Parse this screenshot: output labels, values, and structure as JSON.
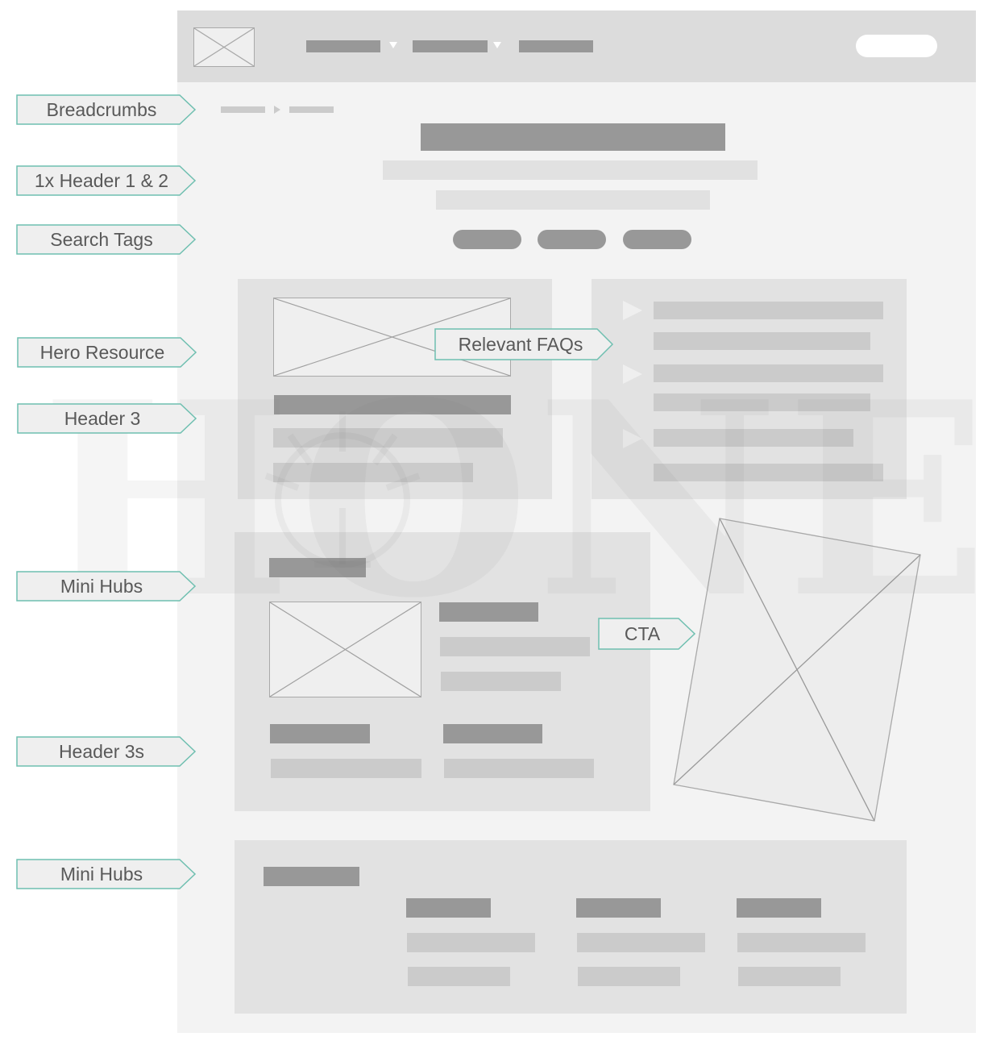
{
  "annotations": [
    {
      "id": "breadcrumbs",
      "label": "Breadcrumbs"
    },
    {
      "id": "header-1-2",
      "label": "1x Header 1 & 2"
    },
    {
      "id": "search-tags",
      "label": "Search Tags"
    },
    {
      "id": "hero-resource",
      "label": "Hero Resource"
    },
    {
      "id": "header-3",
      "label": "Header 3"
    },
    {
      "id": "mini-hubs-1",
      "label": "Mini Hubs"
    },
    {
      "id": "header-3s",
      "label": "Header 3s"
    },
    {
      "id": "mini-hubs-2",
      "label": "Mini Hubs"
    },
    {
      "id": "relevant-faqs",
      "label": "Relevant FAQs"
    },
    {
      "id": "cta",
      "label": "CTA"
    }
  ],
  "watermark": {
    "text": "HONED"
  },
  "nav": {
    "items": [
      {
        "name": "nav-item-1",
        "has_dropdown": true
      },
      {
        "name": "nav-item-2",
        "has_dropdown": true
      },
      {
        "name": "nav-item-3",
        "has_dropdown": false
      }
    ],
    "search_icon": "image-placeholder-icon",
    "dropdown_icon": "caret-down-icon"
  },
  "colors": {
    "accent": "#6fbfb0",
    "label_text": "#595959",
    "page_bg": "#f3f3f3",
    "header_bg": "#dcdcdc",
    "placeholder_dark": "#989898",
    "placeholder_mid": "#cbcbcb",
    "panel_bg": "#e2e2e2"
  },
  "faq": {
    "item_count": 3,
    "expand_icon": "play-triangle-icon"
  },
  "search_tags": {
    "count": 3
  },
  "bottom_hub": {
    "columns": 3
  }
}
